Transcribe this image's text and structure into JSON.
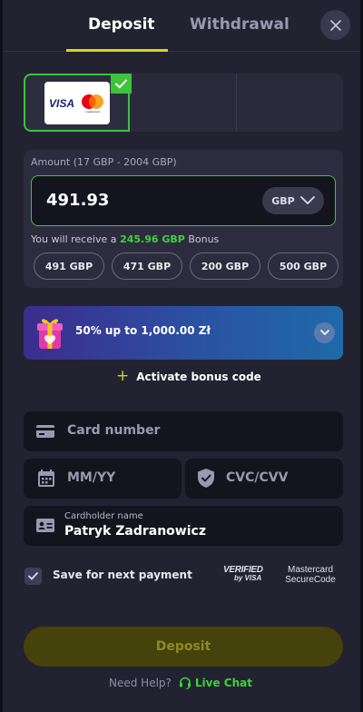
{
  "tabs": {
    "deposit": "Deposit",
    "withdrawal": "Withdrawal"
  },
  "payment_methods": {
    "selected": {
      "brand_visa": "VISA",
      "brand_mastercard": "mastercard"
    }
  },
  "amount": {
    "label": "Amount (17 GBP - 2004 GBP)",
    "value": "491.93",
    "currency": "GBP",
    "bonus_prefix": "You will receive a",
    "bonus_amount": "245.96 GBP",
    "bonus_suffix": "Bonus",
    "presets": [
      "491 GBP",
      "471 GBP",
      "200 GBP",
      "500 GBP"
    ]
  },
  "bonus": {
    "offer": "50% up to 1,000.00 Zł",
    "activate_label": "Activate bonus code"
  },
  "form": {
    "card_number_placeholder": "Card number",
    "expiry_placeholder": "MM/YY",
    "cvc_placeholder": "CVC/CVV",
    "cardholder_label": "Cardholder name",
    "cardholder_value": "Patryk Zadranowicz"
  },
  "save": {
    "label": "Save for next payment",
    "checked": true
  },
  "badges": {
    "verified_visa_line1": "VERIFIED",
    "verified_visa_line2": "by VISA",
    "mastercard_line1": "Mastercard",
    "mastercard_line2": "SecureCode"
  },
  "footer": {
    "deposit_button": "Deposit",
    "need_help": "Need Help?",
    "live_chat": "Live Chat"
  },
  "colors": {
    "accent_green": "#3cc43c",
    "accent_yellow": "#d6d61a",
    "panel_bg": "#222231"
  },
  "icons": [
    "close-icon",
    "check-icon",
    "chevron-down-icon",
    "gift-icon",
    "plus-icon",
    "card-icon",
    "calendar-icon",
    "shield-icon",
    "id-card-icon",
    "headset-icon"
  ]
}
